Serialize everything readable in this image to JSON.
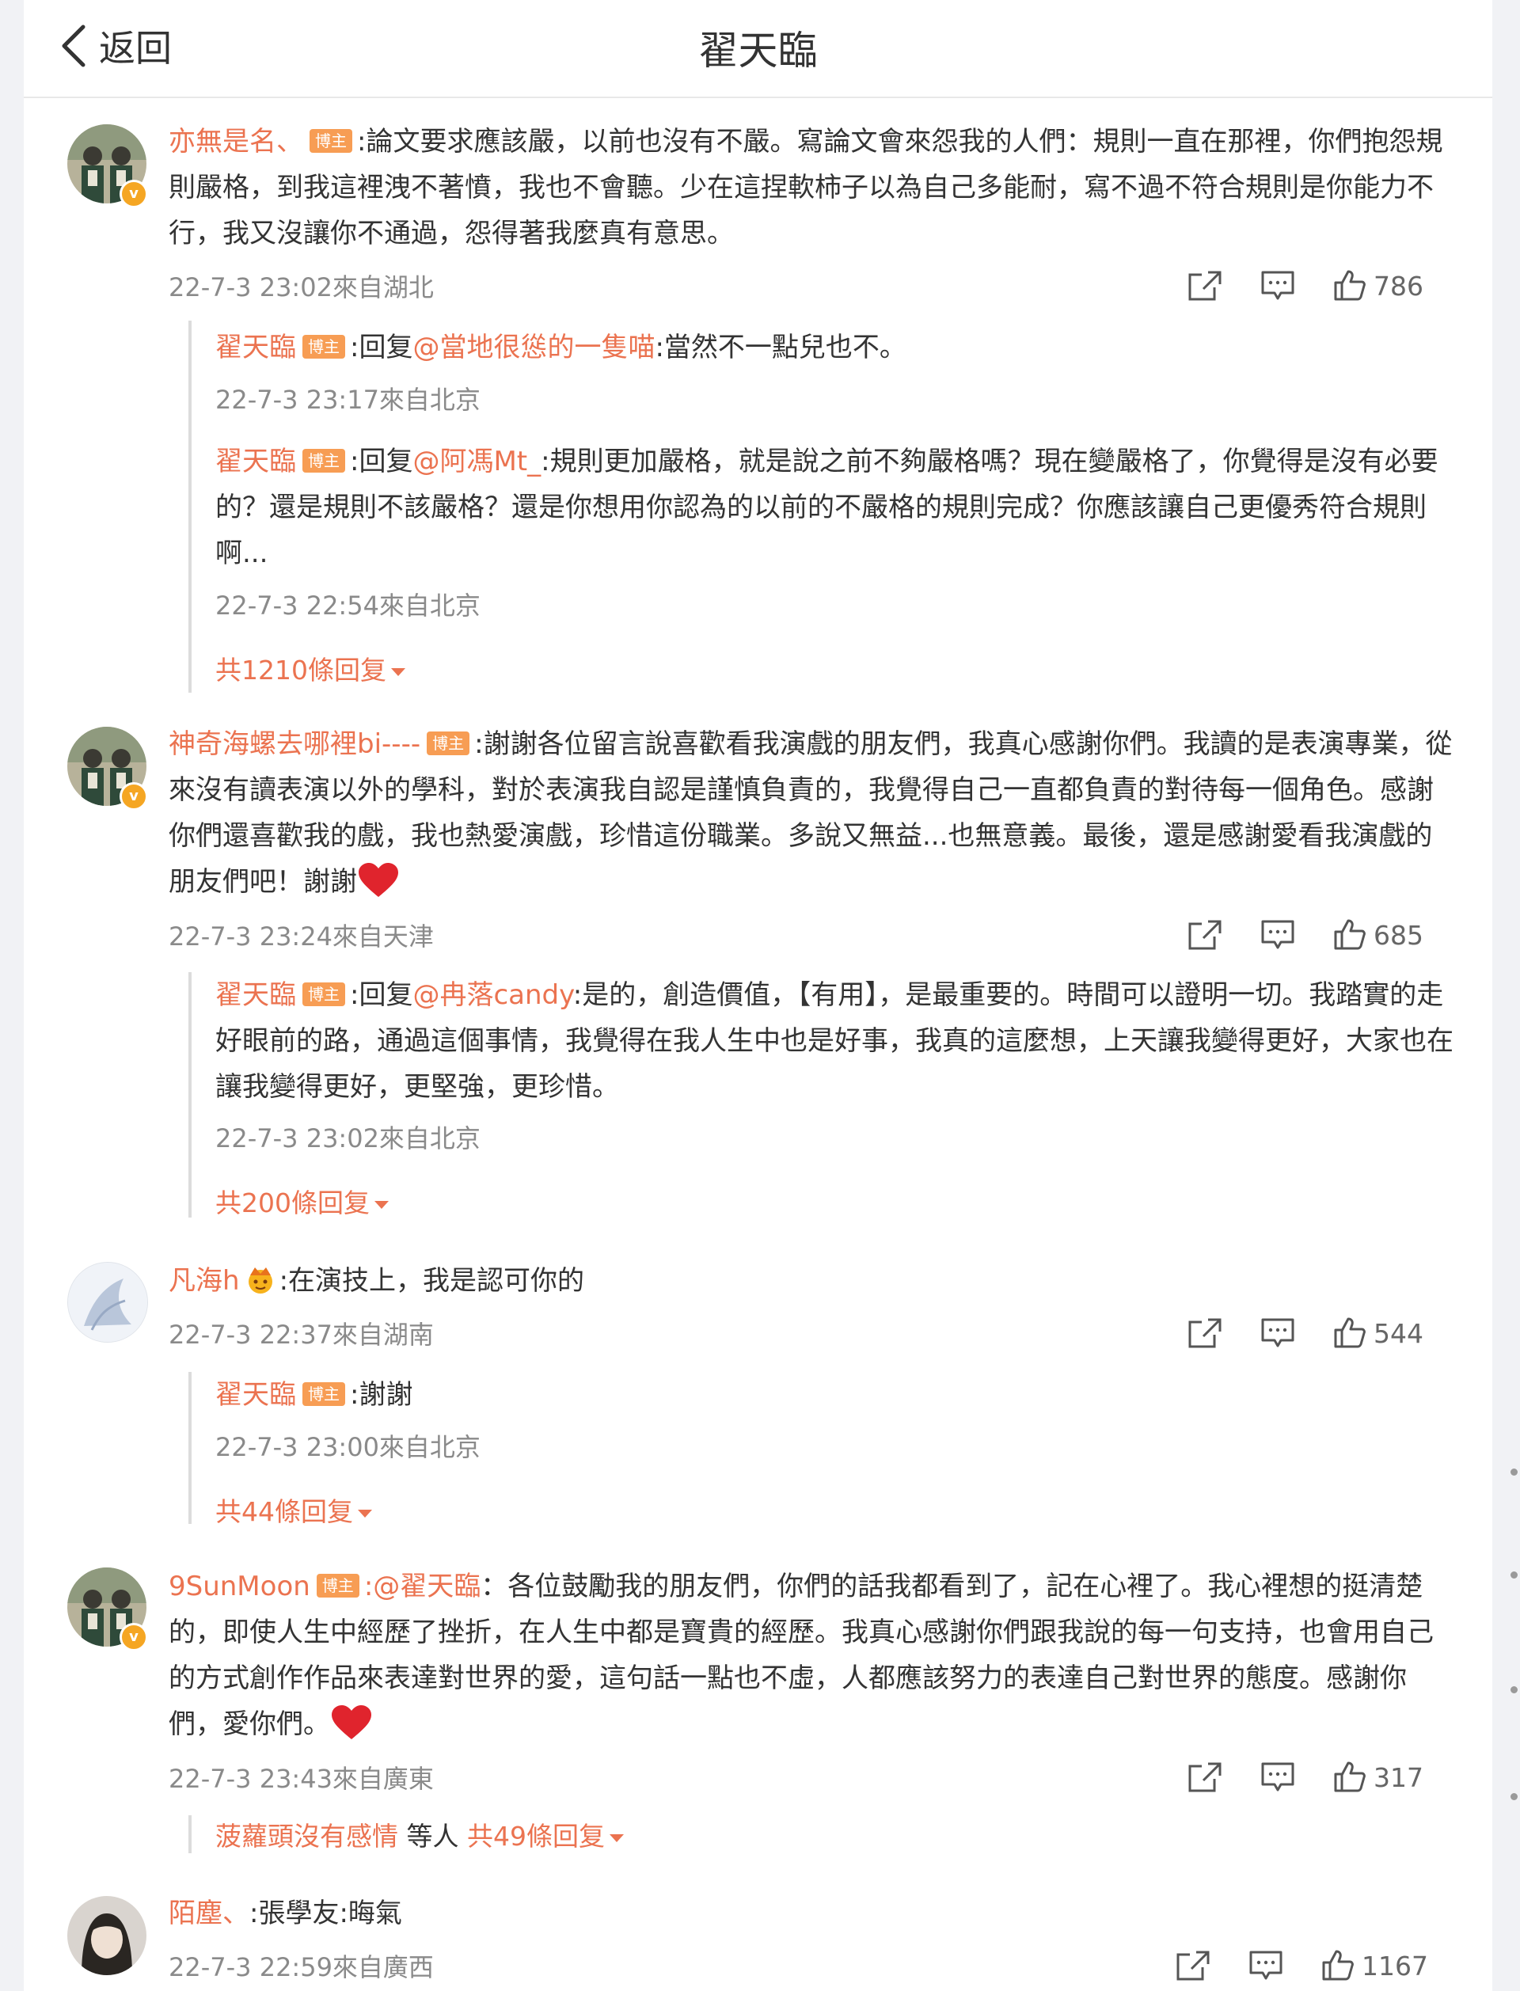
{
  "header": {
    "back_label": "返回",
    "title": "翟天臨"
  },
  "tag_label": "博主",
  "comments": [
    {
      "user": "亦無是名、",
      "text": ":論文要求應該嚴，以前也沒有不嚴。寫論文會來怨我的人們：規則一直在那裡，你們抱怨規則嚴格，到我這裡洩不著憤，我也不會聽。少在這捏軟柿子以為自己多能耐，寫不過不符合規則是你能力不行，我又沒讓你不通過，怨得著我麼真有意思。",
      "meta": "22-7-3 23:02來自湖北",
      "likes": "786",
      "replies": [
        {
          "user": "翟天臨",
          "prefix": ":回复",
          "mention": "@當地很慫的一隻喵",
          "text": ":當然不一點兒也不。",
          "meta": "22-7-3 23:17來自北京"
        },
        {
          "user": "翟天臨",
          "prefix": ":回复",
          "mention": "@阿馮Mt_",
          "text": ":規則更加嚴格，就是說之前不夠嚴格嗎？現在變嚴格了，你覺得是沒有必要的？還是規則不該嚴格？還是你想用你認為的以前的不嚴格的規則完成？你應該讓自己更優秀符合規則啊...",
          "meta": "22-7-3 22:54來自北京"
        }
      ],
      "more": "共1210條回复"
    },
    {
      "user": "神奇海螺去哪裡bi----",
      "text": ":謝謝各位留言說喜歡看我演戲的朋友們，我真心感謝你們。我讀的是表演專業，從來沒有讀表演以外的學科，對於表演我自認是謹慎負責的，我覺得自己一直都負責的對待每一個角色。感謝你們還喜歡我的戲，我也熱愛演戲，珍惜這份職業。多說又無益...也無意義。最後，還是感謝愛看我演戲的朋友們吧！謝謝",
      "meta": "22-7-3 23:24來自天津",
      "likes": "685",
      "replies": [
        {
          "user": "翟天臨",
          "prefix": ":回复",
          "mention": "@冉落candy",
          "text": ":是的，創造價值，【有用】，是最重要的。時間可以證明一切。我踏實的走好眼前的路，通過這個事情，我覺得在我人生中也是好事，我真的這麼想，上天讓我變得更好，大家也在讓我變得更好，更堅強，更珍惜。",
          "meta": "22-7-3 23:02來自北京"
        }
      ],
      "more": "共200條回复"
    },
    {
      "user": "凡海h",
      "text": ":在演技上，我是認可你的",
      "meta": "22-7-3 22:37來自湖南",
      "likes": "544",
      "replies": [
        {
          "user": "翟天臨",
          "prefix": "",
          "mention": "",
          "text": ":謝謝",
          "meta": "22-7-3 23:00來自北京"
        }
      ],
      "more": "共44條回复"
    },
    {
      "user": "9SunMoon",
      "mention": ":@翟天臨",
      "text": "：各位鼓勵我的朋友們，你們的話我都看到了，記在心裡了。我心裡想的挺清楚的，即使人生中經歷了挫折，在人生中都是寶貴的經歷。我真心感謝你們跟我說的每一句支持，也會用自己的方式創作作品來表達對世界的愛，這句話一點也不虛，人都應該努力的表達自己對世界的態度。感謝你們，愛你們。",
      "meta": "22-7-3 23:43來自廣東",
      "likes": "317",
      "more_user": "菠蘿頭沒有感情",
      "more_mid": " 等人 ",
      "more": "共49條回复"
    },
    {
      "user": "陌塵、",
      "text": ":張學友:晦氣",
      "meta": "22-7-3 22:59來自廣西",
      "likes": "1167"
    }
  ],
  "icons": {
    "share": "share-icon",
    "comment": "comment-icon",
    "like": "thumbs-up-icon",
    "back": "chevron-left-icon",
    "heart": "heart-icon",
    "crown": "crown-icon",
    "verified": "verified-badge-icon"
  },
  "colors": {
    "username": "#eb7350",
    "tag": "#f79d54",
    "meta": "#8a8a8a",
    "text": "#333333"
  }
}
